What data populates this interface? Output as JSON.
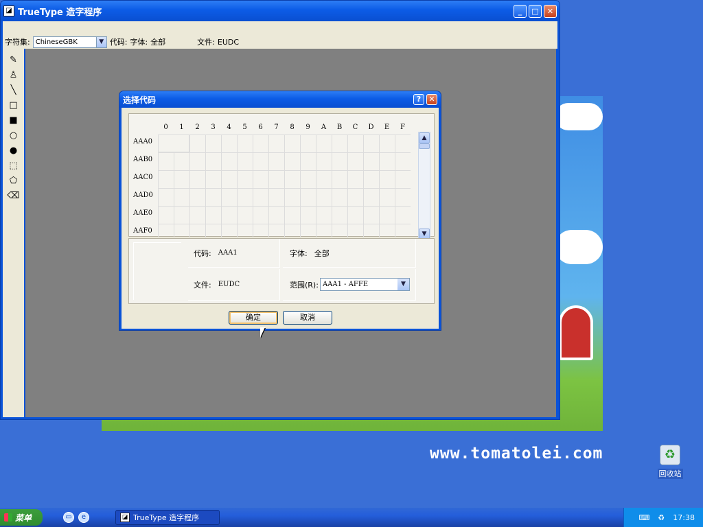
{
  "desktop": {
    "watermark": "www.tomatolei.com",
    "recycle_bin_label": "回收站"
  },
  "main_window": {
    "title": "TrueType 造字程序"
  },
  "toolbar": {
    "charset_label": "字符集:",
    "charset_value": "ChineseGBK",
    "code_label": "代码:",
    "font_label": "字体:",
    "font_value": "全部",
    "file_label": "文件:",
    "file_value": "EUDC"
  },
  "tools": [
    {
      "name": "pencil-icon",
      "glyph": "✎"
    },
    {
      "name": "brush-icon",
      "glyph": "♙"
    },
    {
      "name": "line-icon",
      "glyph": "╲"
    },
    {
      "name": "rect-outline-icon",
      "glyph": "□"
    },
    {
      "name": "rect-filled-icon",
      "glyph": "■"
    },
    {
      "name": "ellipse-outline-icon",
      "glyph": "○"
    },
    {
      "name": "ellipse-filled-icon",
      "glyph": "●"
    },
    {
      "name": "rect-select-icon",
      "glyph": "⬚"
    },
    {
      "name": "freeform-select-icon",
      "glyph": "⬠"
    },
    {
      "name": "eraser-icon",
      "glyph": "⌫"
    }
  ],
  "dialog": {
    "title": "选择代码",
    "columns": [
      "0",
      "1",
      "2",
      "3",
      "4",
      "5",
      "6",
      "7",
      "8",
      "9",
      "A",
      "B",
      "C",
      "D",
      "E",
      "F"
    ],
    "rows": [
      "AAA0",
      "AAB0",
      "AAC0",
      "AAD0",
      "AAE0",
      "AAF0"
    ],
    "code_label": "代码:",
    "code_value": "AAA1",
    "font_label": "字体:",
    "font_value": "全部",
    "file_label": "文件:",
    "file_value": "EUDC",
    "range_label": "范围(R):",
    "range_value": "AAA1 - AFFE",
    "ok_label": "确定",
    "cancel_label": "取消"
  },
  "taskbar": {
    "start_label": "菜单",
    "task_title": "TrueType 造字程序",
    "clock": "17:38"
  }
}
